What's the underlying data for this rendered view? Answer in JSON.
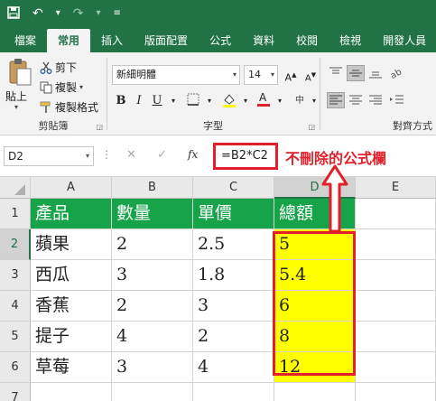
{
  "quick_access": {
    "save_icon": "save-icon",
    "undo_icon": "undo-icon",
    "redo_icon": "redo-icon",
    "customize_icon": "customize-icon"
  },
  "tabs": [
    {
      "label": "檔案",
      "active": false
    },
    {
      "label": "常用",
      "active": true
    },
    {
      "label": "插入",
      "active": false
    },
    {
      "label": "版面配置",
      "active": false
    },
    {
      "label": "公式",
      "active": false
    },
    {
      "label": "資料",
      "active": false
    },
    {
      "label": "校閱",
      "active": false
    },
    {
      "label": "檢視",
      "active": false
    },
    {
      "label": "開發人員",
      "active": false
    }
  ],
  "ribbon": {
    "clipboard": {
      "paste_label": "貼上",
      "cut_label": "剪下",
      "copy_label": "複製",
      "format_painter_label": "複製格式",
      "group_label": "剪貼簿"
    },
    "font": {
      "font_name": "新細明體",
      "font_size": "14",
      "bold": "B",
      "italic": "I",
      "underline": "U",
      "group_label": "字型"
    },
    "alignment": {
      "group_label": "對齊方式"
    }
  },
  "formula_bar": {
    "name_box": "D2",
    "formula": "=B2*C2",
    "note": "不刪除的公式欄"
  },
  "columns": [
    "A",
    "B",
    "C",
    "D",
    "E"
  ],
  "selected_column": "D",
  "rows": [
    {
      "num": "1",
      "cells": [
        "產品",
        "數量",
        "單價",
        "總額",
        ""
      ]
    },
    {
      "num": "2",
      "cells": [
        "蘋果",
        "2",
        "2.5",
        "5",
        ""
      ]
    },
    {
      "num": "3",
      "cells": [
        "西瓜",
        "3",
        "1.8",
        "5.4",
        ""
      ]
    },
    {
      "num": "4",
      "cells": [
        "香蕉",
        "2",
        "3",
        "6",
        ""
      ]
    },
    {
      "num": "5",
      "cells": [
        "提子",
        "4",
        "2",
        "8",
        ""
      ]
    },
    {
      "num": "6",
      "cells": [
        "草莓",
        "3",
        "4",
        "12",
        ""
      ]
    },
    {
      "num": "7",
      "cells": [
        "",
        "",
        "",
        "",
        ""
      ]
    }
  ],
  "selected_row": "2",
  "colors": {
    "excel_green": "#217346",
    "header_fill": "#16a34a",
    "result_fill": "#ffff00",
    "annotation_red": "#e2202a"
  }
}
